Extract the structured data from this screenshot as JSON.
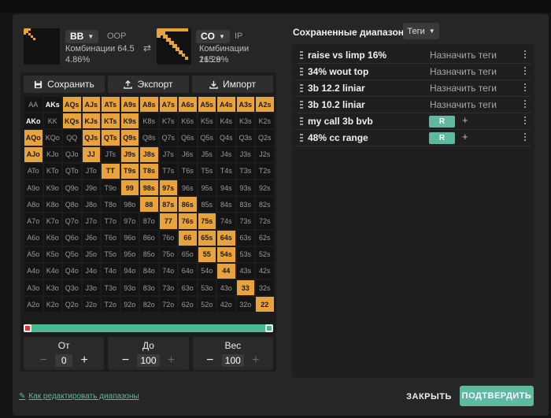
{
  "players": {
    "left": {
      "name": "BB",
      "position": "OOP",
      "combos": "Комбинации 64.5",
      "pct": "4.86%"
    },
    "right": {
      "name": "CO",
      "position": "IP",
      "combos": "Комбинации 215.9",
      "pct": "16.28%"
    }
  },
  "toolbar": {
    "save": "Сохранить",
    "export": "Экспорт",
    "import": "Импорт"
  },
  "grid": {
    "rows": [
      [
        "AA",
        "AKs",
        "AQs",
        "AJs",
        "ATs",
        "A9s",
        "A8s",
        "A7s",
        "A6s",
        "A5s",
        "A4s",
        "A3s",
        "A2s"
      ],
      [
        "AKo",
        "KK",
        "KQs",
        "KJs",
        "KTs",
        "K9s",
        "K8s",
        "K7s",
        "K6s",
        "K5s",
        "K4s",
        "K3s",
        "K2s"
      ],
      [
        "AQo",
        "KQo",
        "QQ",
        "QJs",
        "QTs",
        "Q9s",
        "Q8s",
        "Q7s",
        "Q6s",
        "Q5s",
        "Q4s",
        "Q3s",
        "Q2s"
      ],
      [
        "AJo",
        "KJo",
        "QJo",
        "JJ",
        "JTs",
        "J9s",
        "J8s",
        "J7s",
        "J6s",
        "J5s",
        "J4s",
        "J3s",
        "J2s"
      ],
      [
        "ATo",
        "KTo",
        "QTo",
        "JTo",
        "TT",
        "T9s",
        "T8s",
        "T7s",
        "T6s",
        "T5s",
        "T4s",
        "T3s",
        "T2s"
      ],
      [
        "A9o",
        "K9o",
        "Q9o",
        "J9o",
        "T9o",
        "99",
        "98s",
        "97s",
        "96s",
        "95s",
        "94s",
        "93s",
        "92s"
      ],
      [
        "A8o",
        "K8o",
        "Q8o",
        "J8o",
        "T8o",
        "98o",
        "88",
        "87s",
        "86s",
        "85s",
        "84s",
        "83s",
        "82s"
      ],
      [
        "A7o",
        "K7o",
        "Q7o",
        "J7o",
        "T7o",
        "97o",
        "87o",
        "77",
        "76s",
        "75s",
        "74s",
        "73s",
        "72s"
      ],
      [
        "A6o",
        "K6o",
        "Q6o",
        "J6o",
        "T6o",
        "96o",
        "86o",
        "76o",
        "66",
        "65s",
        "64s",
        "63s",
        "62s"
      ],
      [
        "A5o",
        "K5o",
        "Q5o",
        "J5o",
        "T5o",
        "95o",
        "85o",
        "75o",
        "65o",
        "55",
        "54s",
        "53s",
        "52s"
      ],
      [
        "A4o",
        "K4o",
        "Q4o",
        "J4o",
        "T4o",
        "94o",
        "84o",
        "74o",
        "64o",
        "54o",
        "44",
        "43s",
        "42s"
      ],
      [
        "A3o",
        "K3o",
        "Q3o",
        "J3o",
        "T3o",
        "93o",
        "83o",
        "73o",
        "63o",
        "53o",
        "43o",
        "33",
        "32s"
      ],
      [
        "A2o",
        "K2o",
        "Q2o",
        "J2o",
        "T2o",
        "92o",
        "82o",
        "72o",
        "62o",
        "52o",
        "42o",
        "32o",
        "22"
      ]
    ],
    "active": [
      "AQs",
      "AJs",
      "ATs",
      "A9s",
      "A8s",
      "A7s",
      "A6s",
      "A5s",
      "A4s",
      "A3s",
      "A2s",
      "KQs",
      "KJs",
      "KTs",
      "K9s",
      "AQo",
      "QJs",
      "QTs",
      "Q9s",
      "AJo",
      "JJ",
      "J9s",
      "J8s",
      "TT",
      "T9s",
      "T8s",
      "99",
      "98s",
      "97s",
      "88",
      "87s",
      "86s",
      "77",
      "76s",
      "75s",
      "66",
      "65s",
      "64s",
      "55",
      "54s",
      "44",
      "33",
      "22"
    ],
    "selected": [
      "AKs",
      "AKo"
    ]
  },
  "inputs": {
    "from": {
      "label": "От",
      "value": "0"
    },
    "to": {
      "label": "До",
      "value": "100"
    },
    "weight": {
      "label": "Вес",
      "value": "100"
    }
  },
  "saved": {
    "title": "Сохраненные диапазоны",
    "tags_button": "Теги",
    "assign_label": "Назначить теги",
    "tag_label": "R",
    "items": [
      {
        "name": "raise vs limp 16%",
        "tagged": false
      },
      {
        "name": "34% wout top",
        "tagged": false
      },
      {
        "name": "3b 12.2 liniar",
        "tagged": false
      },
      {
        "name": "3b 10.2 liniar",
        "tagged": false
      },
      {
        "name": "my call 3b bvb",
        "tagged": true
      },
      {
        "name": "48% cc range",
        "tagged": true
      }
    ]
  },
  "footer": {
    "help": "Как редактировать диапазоны",
    "close": "ЗАКРЫТЬ",
    "confirm": "ПОДТВЕРДИТЬ"
  },
  "colors": {
    "accent": "#e8a33a",
    "teal": "#5fb8a0",
    "panel": "#262626"
  }
}
